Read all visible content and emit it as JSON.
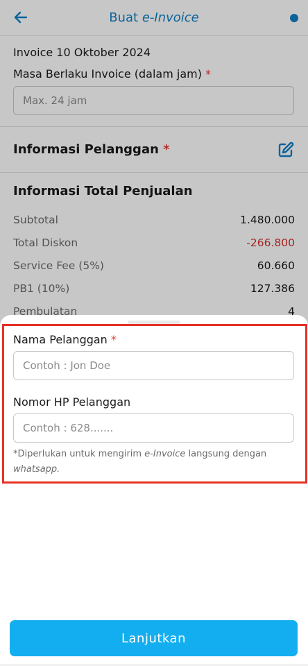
{
  "header": {
    "title_prefix": "Buat ",
    "title_italic": "e-Invoice",
    "accent_color": "#0f7fc6",
    "back_icon": "arrow-left-icon",
    "status_icon": "dot-icon"
  },
  "invoice": {
    "date_title": "Invoice 10 Oktober 2024",
    "validity_label": "Masa Berlaku Invoice (dalam jam) ",
    "required_mark": "*",
    "validity_placeholder": "Max. 24 jam"
  },
  "customer_section": {
    "title": "Informasi Pelanggan ",
    "required_mark": "*",
    "edit_icon": "edit-icon"
  },
  "totals": {
    "title": "Informasi Total Penjualan",
    "rows": [
      {
        "label": "Subtotal",
        "value": "1.480.000"
      },
      {
        "label": "Total Diskon",
        "value": "-266.800"
      },
      {
        "label": "Service Fee (5%)",
        "value": "60.660"
      },
      {
        "label": "PB1 (10%)",
        "value": "127.386"
      },
      {
        "label": "Pembulatan",
        "value": "4"
      }
    ],
    "negative_color": "#d32f2f"
  },
  "sheet": {
    "name_label": "Nama Pelanggan ",
    "required_mark": "*",
    "name_placeholder": "Contoh : Jon Doe",
    "phone_label": "Nomor HP Pelanggan",
    "phone_placeholder": "Contoh : 628.......",
    "note_prefix": "*Diperlukan untuk mengirim ",
    "note_italic": "e-Invoice",
    "note_mid": " langsung dengan ",
    "note_italic_end": "whatsapp.",
    "cta_label": "Lanjutkan",
    "cta_color": "#13aeef",
    "highlight_color": "#e53223"
  }
}
